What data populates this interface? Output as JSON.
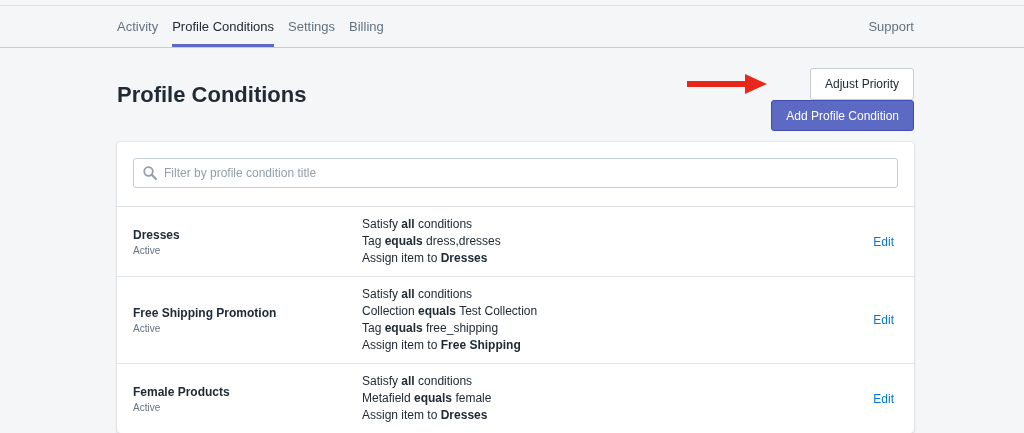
{
  "nav": {
    "tabs": [
      {
        "label": "Activity",
        "selected": false
      },
      {
        "label": "Profile Conditions",
        "selected": true
      },
      {
        "label": "Settings",
        "selected": false
      },
      {
        "label": "Billing",
        "selected": false
      }
    ],
    "support_link": "Support"
  },
  "page_title": "Profile Conditions",
  "actions": {
    "adjust_priority": "Adjust Priority",
    "add_condition": "Add Profile Condition"
  },
  "search": {
    "placeholder": "Filter by profile condition title"
  },
  "conditions": [
    {
      "title": "Dresses",
      "status": "Active",
      "rules": [
        "Satisfy **all** conditions",
        "Tag **equals** dress,dresses",
        "Assign item to **Dresses**"
      ],
      "action": "Edit"
    },
    {
      "title": "Free Shipping Promotion",
      "status": "Active",
      "rules": [
        "Satisfy **all** conditions",
        "Collection **equals** Test Collection",
        "Tag **equals** free_shipping",
        "Assign item to **Free Shipping**"
      ],
      "action": "Edit"
    },
    {
      "title": "Female Products",
      "status": "Active",
      "rules": [
        "Satisfy **all** conditions",
        "Metafield **equals** female",
        "Assign item to **Dresses**"
      ],
      "action": "Edit"
    }
  ]
}
